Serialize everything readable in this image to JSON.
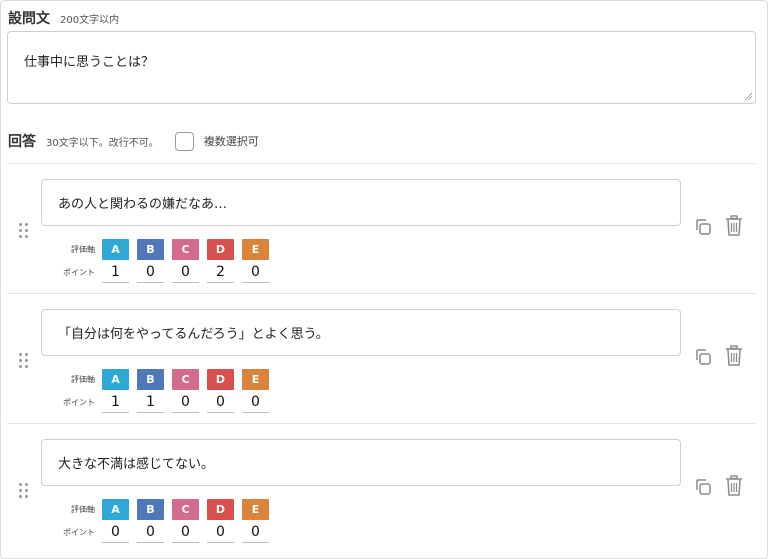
{
  "question": {
    "title": "設問文",
    "hint": "200文字以内",
    "text": "仕事中に思うことは？"
  },
  "answers_section": {
    "title": "回答",
    "hint": "30文字以下。改行不可。",
    "multi_select_label": "複数選択可",
    "multi_select_checked": false
  },
  "labels": {
    "axis": "評価軸",
    "points": "ポイント"
  },
  "axes": [
    {
      "label": "A",
      "color": "#2ea8d6"
    },
    {
      "label": "B",
      "color": "#4f78b8"
    },
    {
      "label": "C",
      "color": "#d46b8c"
    },
    {
      "label": "D",
      "color": "#d84f4f"
    },
    {
      "label": "E",
      "color": "#d9843a"
    }
  ],
  "answers": [
    {
      "text": "あの人と関わるの嫌だなあ…",
      "points": [
        "1",
        "0",
        "0",
        "2",
        "0"
      ]
    },
    {
      "text": "「自分は何をやってるんだろう」とよく思う。",
      "points": [
        "1",
        "1",
        "0",
        "0",
        "0"
      ]
    },
    {
      "text": "大きな不満は感じてない。",
      "points": [
        "0",
        "0",
        "0",
        "0",
        "0"
      ]
    }
  ],
  "icons": {
    "copy": "copy-icon",
    "delete": "trash-icon",
    "drag": "drag-handle-icon"
  }
}
